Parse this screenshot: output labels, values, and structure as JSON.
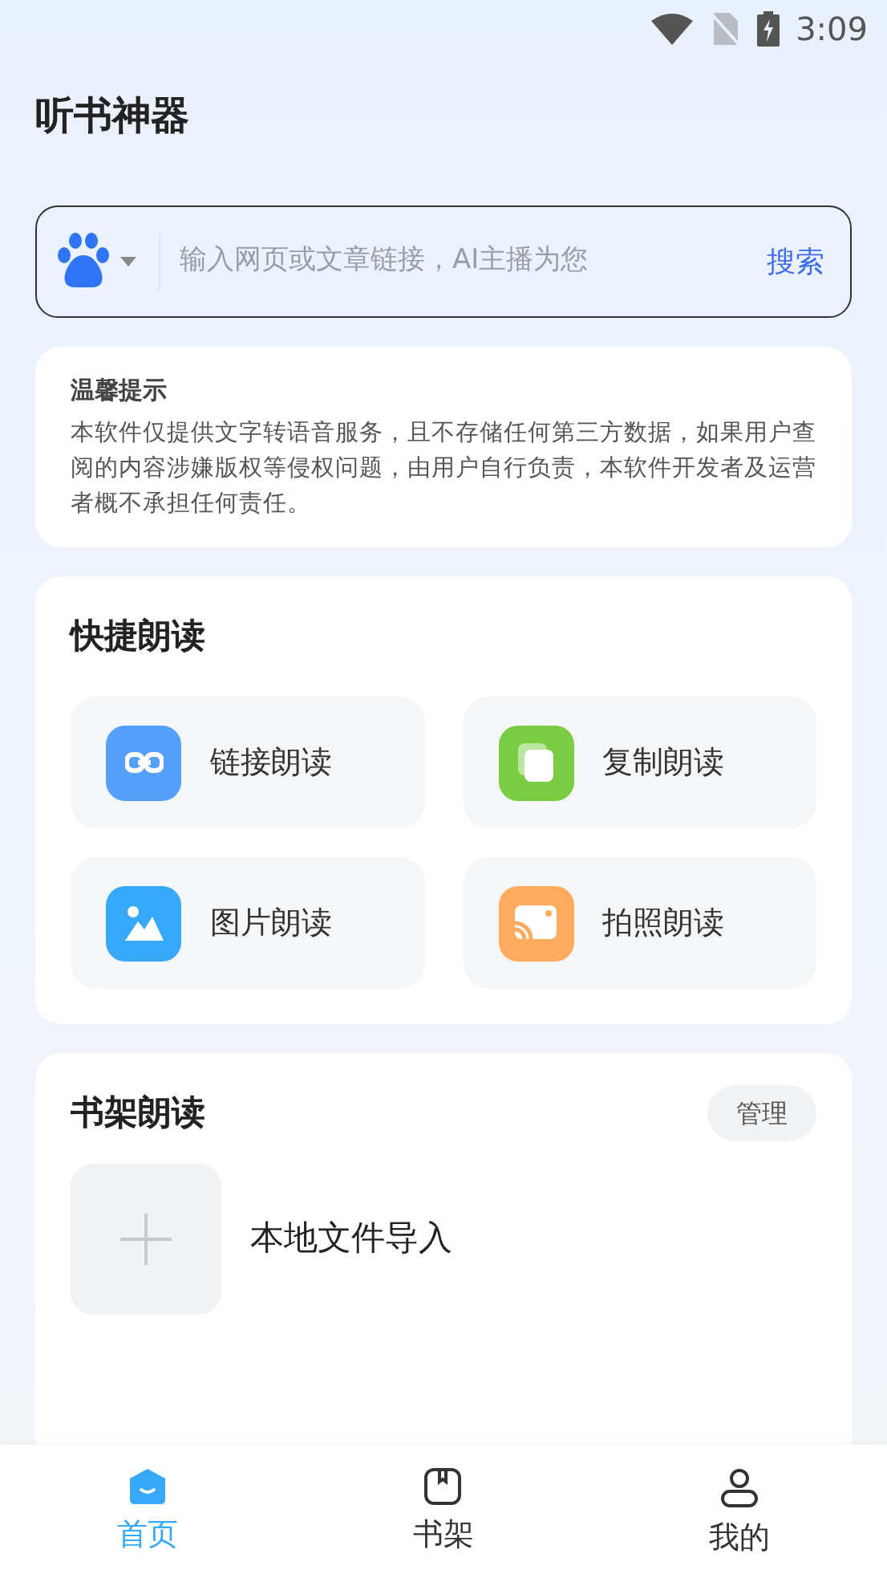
{
  "status_bar": {
    "time": "3:09"
  },
  "title": "听书神器",
  "search": {
    "placeholder": "输入网页或文章链接，AI主播为您",
    "button": "搜索"
  },
  "notice": {
    "title": "温馨提示",
    "text": "本软件仅提供文字转语音服务，且不存储任何第三方数据，如果用户查阅的内容涉嫌版权等侵权问题，由用户自行负责，本软件开发者及运营者概不承担任何责任。"
  },
  "quick": {
    "title": "快捷朗读",
    "items": [
      {
        "label": "链接朗读",
        "kind": "link",
        "color": "#559ffd"
      },
      {
        "label": "复制朗读",
        "kind": "copy",
        "color": "#7acc42"
      },
      {
        "label": "图片朗读",
        "kind": "image",
        "color": "#38a8fa"
      },
      {
        "label": "拍照朗读",
        "kind": "camera",
        "color": "#ffaa5c"
      }
    ]
  },
  "shelf": {
    "title": "书架朗读",
    "manage": "管理",
    "import": "本地文件导入"
  },
  "tabs": [
    {
      "label": "首页",
      "kind": "home",
      "selected": true
    },
    {
      "label": "书架",
      "kind": "shelf",
      "selected": false
    },
    {
      "label": "我的",
      "kind": "me",
      "selected": false
    }
  ]
}
